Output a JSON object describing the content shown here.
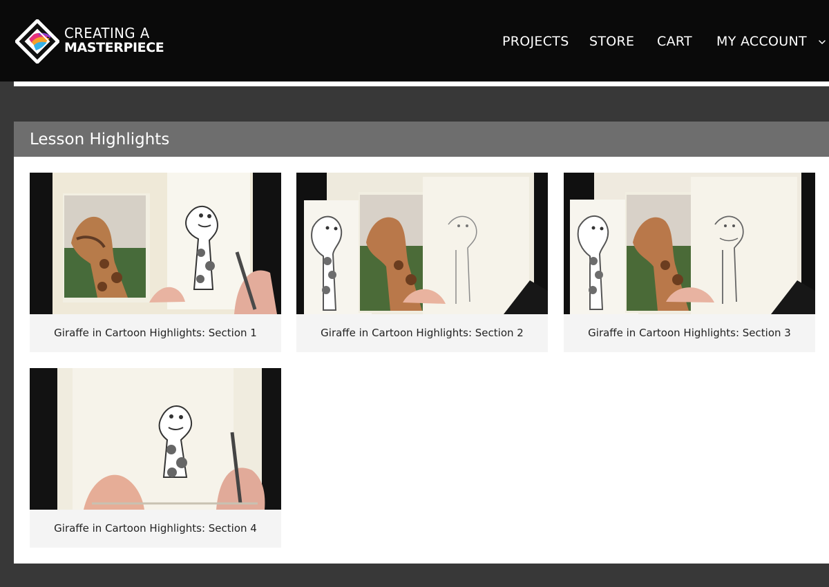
{
  "brand": {
    "line1": "CREATING A",
    "line2": "MASTERPIECE"
  },
  "nav": {
    "projects": "PROJECTS",
    "store": "STORE",
    "cart": "CART",
    "account": "MY ACCOUNT",
    "account_icon": "chevron-down-icon"
  },
  "section": {
    "title": "Lesson Highlights"
  },
  "cards": [
    {
      "caption": "Giraffe in Cartoon Highlights: Section 1"
    },
    {
      "caption": "Giraffe in Cartoon Highlights: Section 2"
    },
    {
      "caption": "Giraffe in Cartoon Highlights: Section 3"
    },
    {
      "caption": "Giraffe in Cartoon Highlights: Section 4"
    }
  ],
  "colors": {
    "topbar": "#0a0a0a",
    "page_background": "#383838",
    "section_header": "#6e6e6e",
    "card_background": "#f4f4f4"
  }
}
